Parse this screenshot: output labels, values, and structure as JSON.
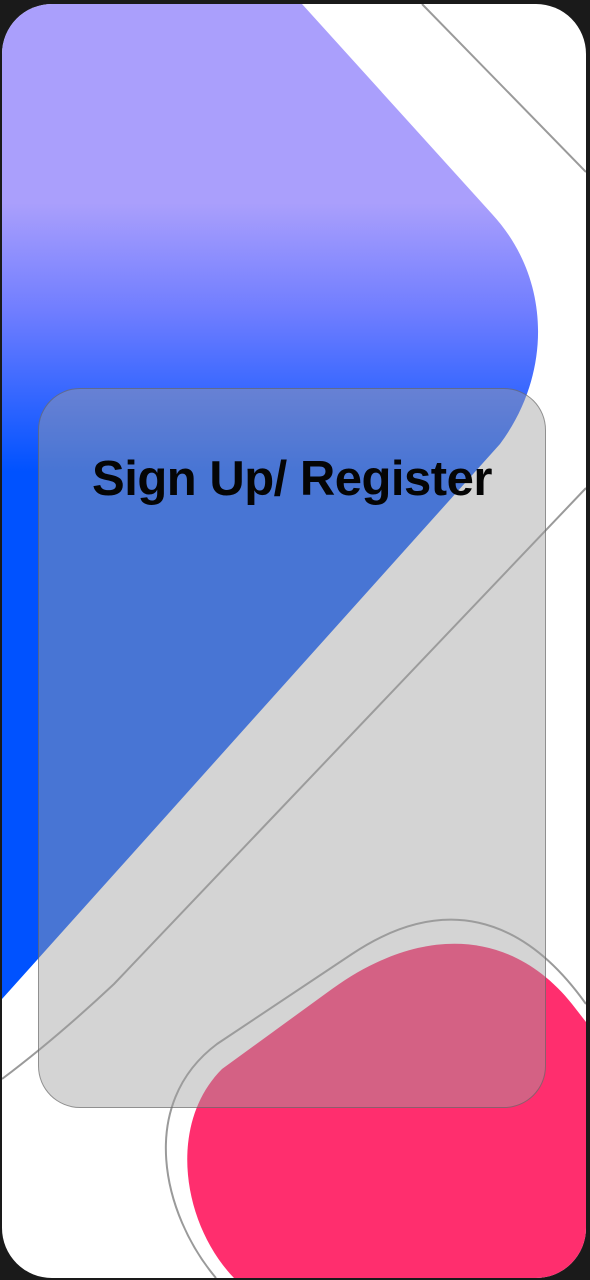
{
  "screen": {
    "title": "Sign Up/ Register"
  },
  "colors": {
    "top_shape_lavender": "#aa9ffc",
    "top_shape_blue": "#0052ff",
    "bottom_blob_pink": "#ff2e6e",
    "outline_gray": "#8a8a8a",
    "glass_card": "#a0a0a0",
    "title_text": "#050505",
    "background": "#ffffff"
  },
  "decorations": [
    "gradient-blob-shape",
    "pink-blob-shape",
    "outline-lines"
  ]
}
